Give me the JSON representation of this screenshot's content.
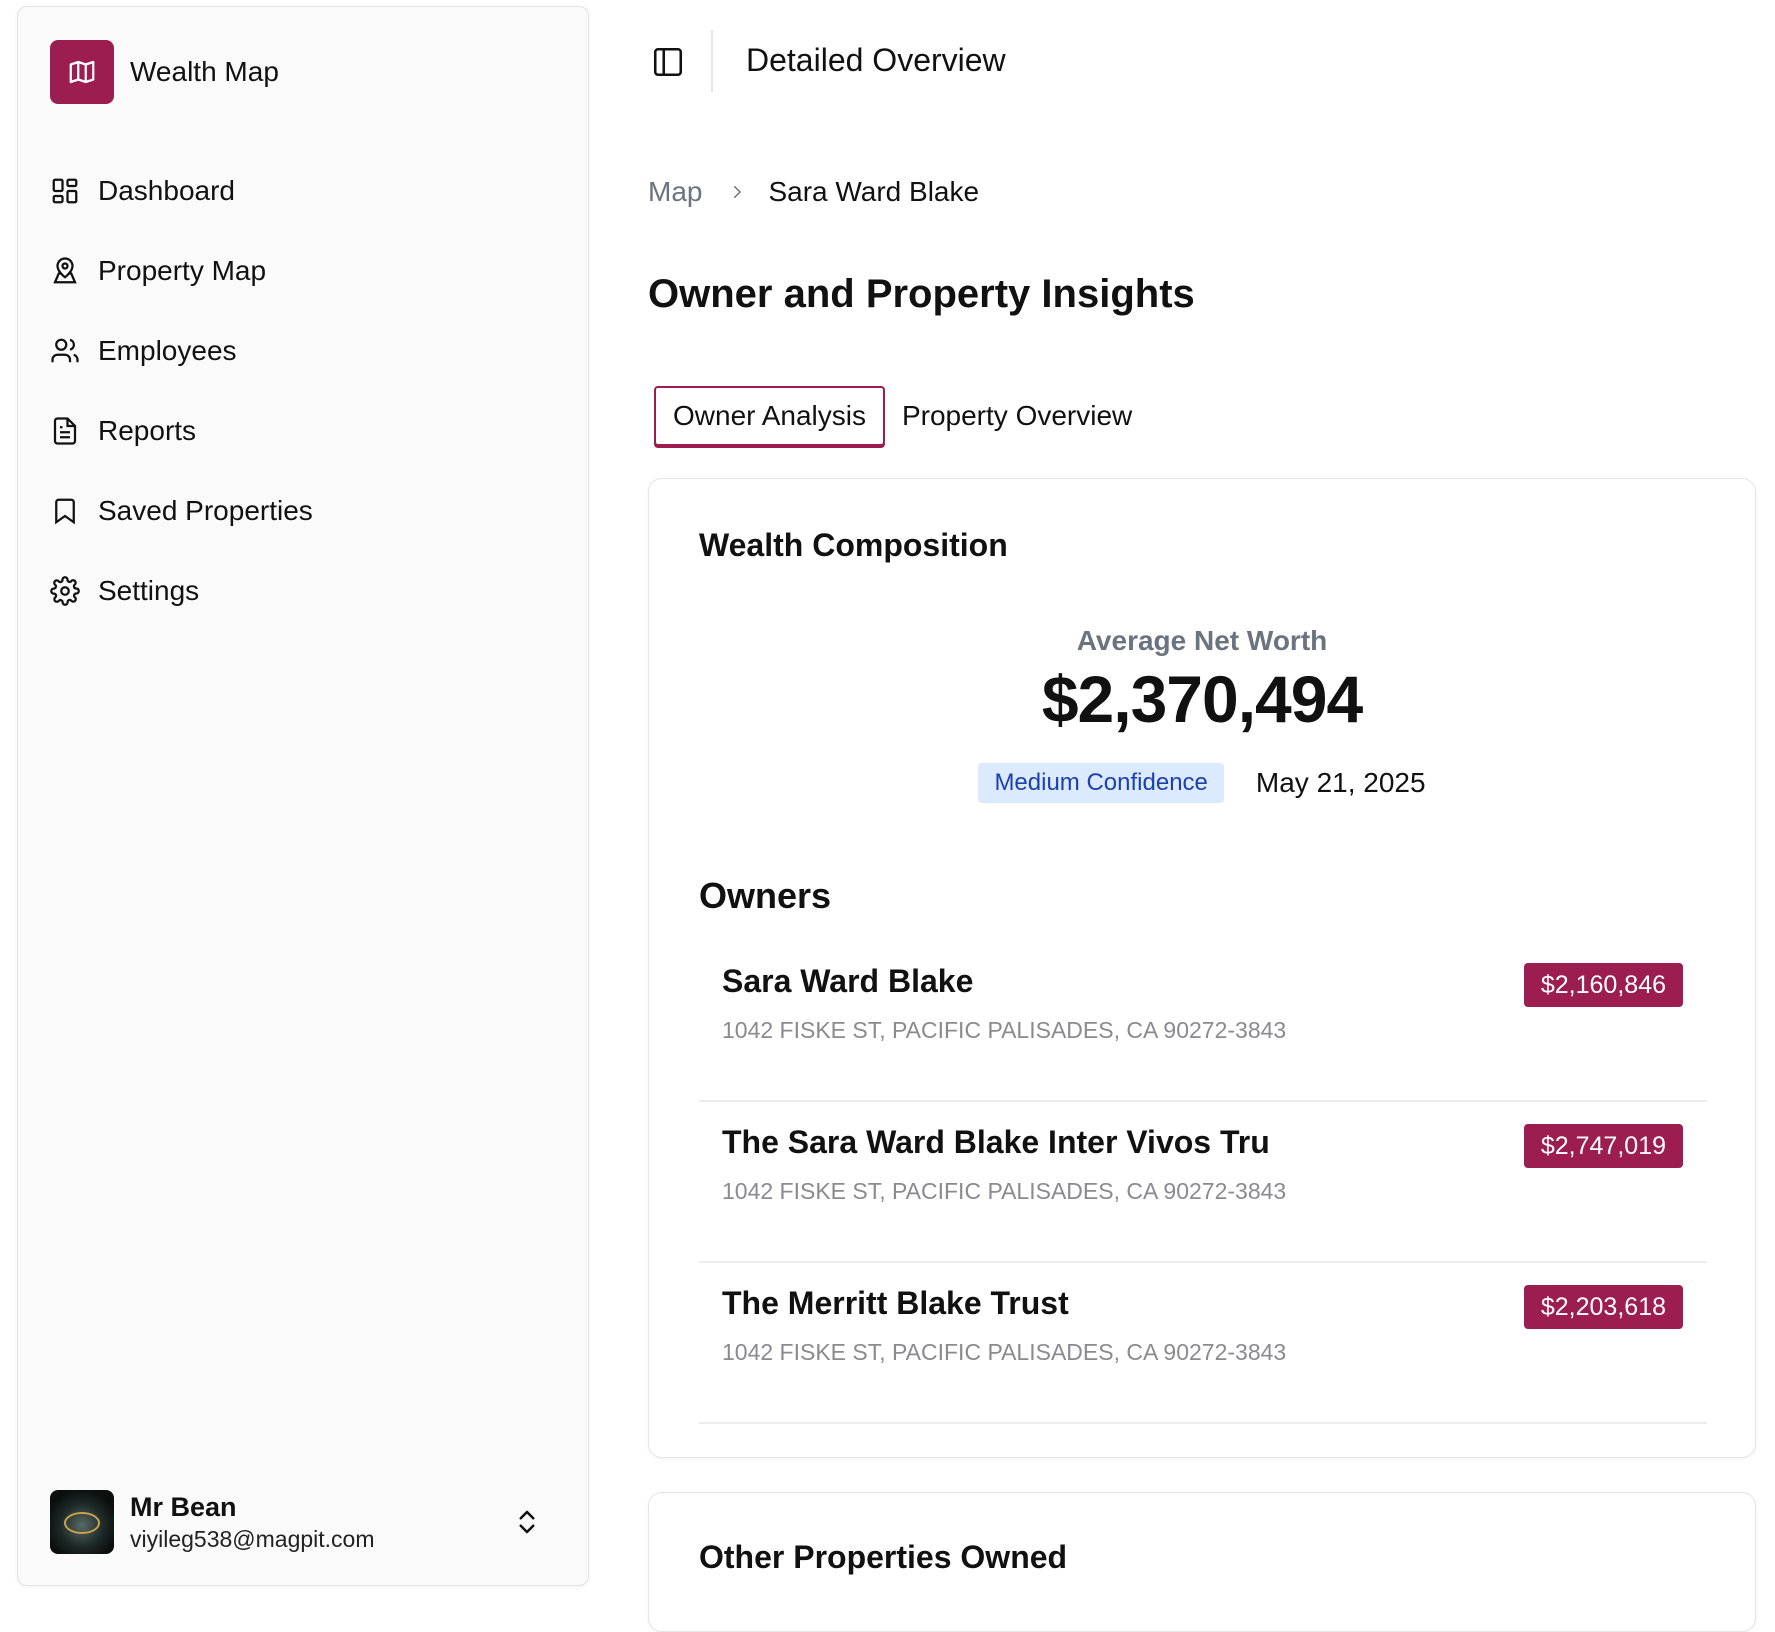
{
  "brand": {
    "name": "Wealth Map",
    "color": "#9c1d4f"
  },
  "sidebar": {
    "items": [
      {
        "label": "Dashboard",
        "icon": "dashboard-icon"
      },
      {
        "label": "Property Map",
        "icon": "map-pin-user-icon"
      },
      {
        "label": "Employees",
        "icon": "users-icon"
      },
      {
        "label": "Reports",
        "icon": "document-icon"
      },
      {
        "label": "Saved Properties",
        "icon": "bookmark-icon"
      },
      {
        "label": "Settings",
        "icon": "gear-icon"
      }
    ]
  },
  "user": {
    "name": "Mr Bean",
    "email": "viyileg538@magpit.com"
  },
  "header": {
    "title": "Detailed Overview"
  },
  "breadcrumb": {
    "root": "Map",
    "current": "Sara Ward Blake"
  },
  "page": {
    "title": "Owner and Property Insights"
  },
  "tabs": [
    {
      "label": "Owner Analysis",
      "active": true
    },
    {
      "label": "Property Overview",
      "active": false
    }
  ],
  "wealth": {
    "title": "Wealth Composition",
    "net_worth_label": "Average Net Worth",
    "net_worth_value": "$2,370,494",
    "confidence": "Medium Confidence",
    "date": "May 21, 2025"
  },
  "owners": {
    "title": "Owners",
    "items": [
      {
        "name": "Sara Ward Blake",
        "address": "1042 FISKE ST, PACIFIC PALISADES, CA 90272-3843",
        "value": "$2,160,846"
      },
      {
        "name": "The Sara Ward Blake Inter Vivos Tru",
        "address": "1042 FISKE ST, PACIFIC PALISADES, CA 90272-3843",
        "value": "$2,747,019"
      },
      {
        "name": "The Merritt Blake Trust",
        "address": "1042 FISKE ST, PACIFIC PALISADES, CA 90272-3843",
        "value": "$2,203,618"
      }
    ]
  },
  "other_properties": {
    "title": "Other Properties Owned"
  }
}
